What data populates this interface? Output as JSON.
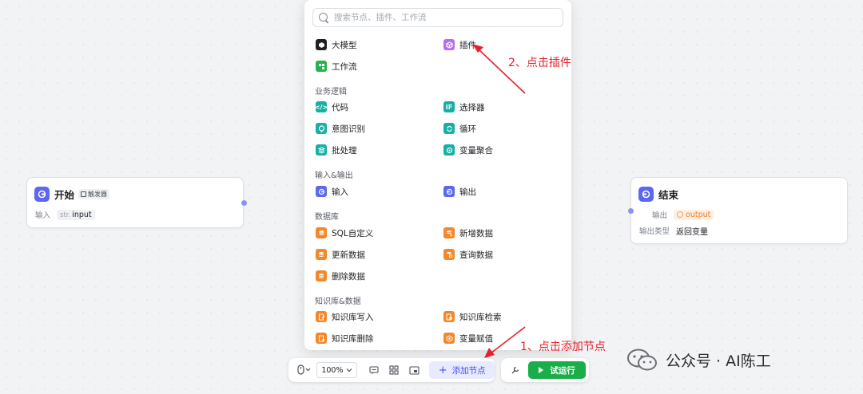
{
  "canvas": {
    "start_node": {
      "title": "开始",
      "trigger_badge": "触发器",
      "input_label": "输入",
      "input_type": "str.",
      "input_name": "input"
    },
    "end_node": {
      "title": "结束",
      "output_label": "输出",
      "output_var": "output",
      "output_type_label": "输出类型",
      "output_type_value": "返回变量"
    }
  },
  "panel": {
    "search_placeholder": "搜索节点、插件、工作流",
    "top_items": [
      {
        "label": "大模型",
        "icon": "llm-icon",
        "color": "#1d1f24"
      },
      {
        "label": "插件",
        "icon": "plugin-icon",
        "color": "#b66ef2"
      },
      {
        "label": "工作流",
        "icon": "workflow-icon",
        "color": "#22b34d"
      }
    ],
    "sections": [
      {
        "title": "业务逻辑",
        "items": [
          {
            "label": "代码",
            "icon": "code-icon",
            "color": "#16b0a4"
          },
          {
            "label": "选择器",
            "icon": "if-icon",
            "glyph": "IF",
            "color": "#16b0a4"
          },
          {
            "label": "意图识别",
            "icon": "intent-icon",
            "color": "#16b0a4"
          },
          {
            "label": "循环",
            "icon": "loop-icon",
            "color": "#16b0a4"
          },
          {
            "label": "批处理",
            "icon": "batch-icon",
            "color": "#16b0a4"
          },
          {
            "label": "变量聚合",
            "icon": "aggregate-icon",
            "color": "#16b0a4"
          }
        ]
      },
      {
        "title": "输入&输出",
        "items": [
          {
            "label": "输入",
            "icon": "input-icon",
            "color": "#5b67f1"
          },
          {
            "label": "输出",
            "icon": "output-icon",
            "color": "#5b67f1"
          }
        ]
      },
      {
        "title": "数据库",
        "items": [
          {
            "label": "SQL自定义",
            "icon": "sql-icon",
            "color": "#f3872a"
          },
          {
            "label": "新增数据",
            "icon": "db-add-icon",
            "color": "#f3872a"
          },
          {
            "label": "更新数据",
            "icon": "db-update-icon",
            "color": "#f3872a"
          },
          {
            "label": "查询数据",
            "icon": "db-query-icon",
            "color": "#f3872a"
          },
          {
            "label": "删除数据",
            "icon": "db-delete-icon",
            "color": "#f3872a"
          }
        ]
      },
      {
        "title": "知识库&数据",
        "items": [
          {
            "label": "知识库写入",
            "icon": "kb-write-icon",
            "color": "#f3872a"
          },
          {
            "label": "知识库检索",
            "icon": "kb-search-icon",
            "color": "#f3872a"
          },
          {
            "label": "知识库删除",
            "icon": "kb-delete-icon",
            "color": "#f3872a"
          },
          {
            "label": "变量赋值",
            "icon": "assign-icon",
            "color": "#f3872a"
          }
        ]
      }
    ]
  },
  "toolbar": {
    "zoom": "100%",
    "add_node_label": "添加节点",
    "test_run_label": "试运行"
  },
  "annotations": {
    "step1": "1、点击添加节点",
    "step2": "2、点击插件",
    "color": "#e4222b"
  },
  "watermark": {
    "text": "公众号 · AI陈工"
  }
}
